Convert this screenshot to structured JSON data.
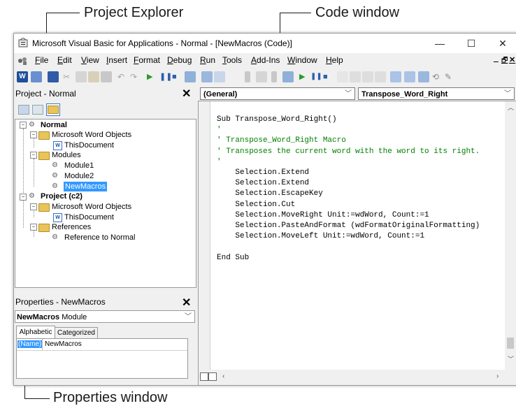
{
  "callouts": {
    "project_explorer": "Project Explorer",
    "code_window": "Code window",
    "properties_window": "Properties window"
  },
  "window": {
    "title": "Microsoft Visual Basic for Applications - Normal - [NewMacros (Code)]",
    "minimize": "—",
    "maximize": "☐",
    "close": "✕",
    "doc_minimize": "_",
    "doc_restore": "🗗",
    "doc_close": "✕"
  },
  "menu": {
    "items": [
      "File",
      "Edit",
      "View",
      "Insert",
      "Format",
      "Debug",
      "Run",
      "Tools",
      "Add-Ins",
      "Window",
      "Help"
    ]
  },
  "project_panel": {
    "title": "Project - Normal",
    "close": "✕",
    "tree": {
      "normal": "Normal",
      "word_objects_1": "Microsoft Word Objects",
      "this_document_1": "ThisDocument",
      "modules": "Modules",
      "module1": "Module1",
      "module2": "Module2",
      "newmacros": "NewMacros",
      "project": "Project (c2)",
      "word_objects_2": "Microsoft Word Objects",
      "this_document_2": "ThisDocument",
      "references": "References",
      "ref_normal": "Reference to Normal"
    }
  },
  "properties_panel": {
    "title": "Properties - NewMacros",
    "close": "✕",
    "object_name": "NewMacros",
    "object_type": "Module",
    "tabs": [
      "Alphabetic",
      "Categorized"
    ],
    "prop_name": "(Name)",
    "prop_value": "NewMacros"
  },
  "code": {
    "object_combo": "(General)",
    "proc_combo": "Transpose_Word_Right",
    "lines": [
      {
        "text": "Sub Transpose_Word_Right()",
        "color": "#000000"
      },
      {
        "text": "'",
        "color": "#008000"
      },
      {
        "text": "' Transpose_Word_Right Macro",
        "color": "#008000"
      },
      {
        "text": "' Transposes the current word with the word to its right.",
        "color": "#008000"
      },
      {
        "text": "'",
        "color": "#008000"
      },
      {
        "text": "    Selection.Extend",
        "color": "#000000"
      },
      {
        "text": "    Selection.Extend",
        "color": "#000000"
      },
      {
        "text": "    Selection.EscapeKey",
        "color": "#000000"
      },
      {
        "text": "    Selection.Cut",
        "color": "#000000"
      },
      {
        "text": "    Selection.MoveRight Unit:=wdWord, Count:=1",
        "color": "#000000"
      },
      {
        "text": "    Selection.PasteAndFormat (wdFormatOriginalFormatting)",
        "color": "#000000"
      },
      {
        "text": "    Selection.MoveLeft Unit:=wdWord, Count:=1",
        "color": "#000000"
      },
      {
        "text": "",
        "color": "#000000"
      },
      {
        "text": "End Sub",
        "color": "#000000"
      }
    ]
  },
  "colors": {
    "selection": "#3399ff",
    "comment": "#008000",
    "keyword": "#00008b"
  }
}
